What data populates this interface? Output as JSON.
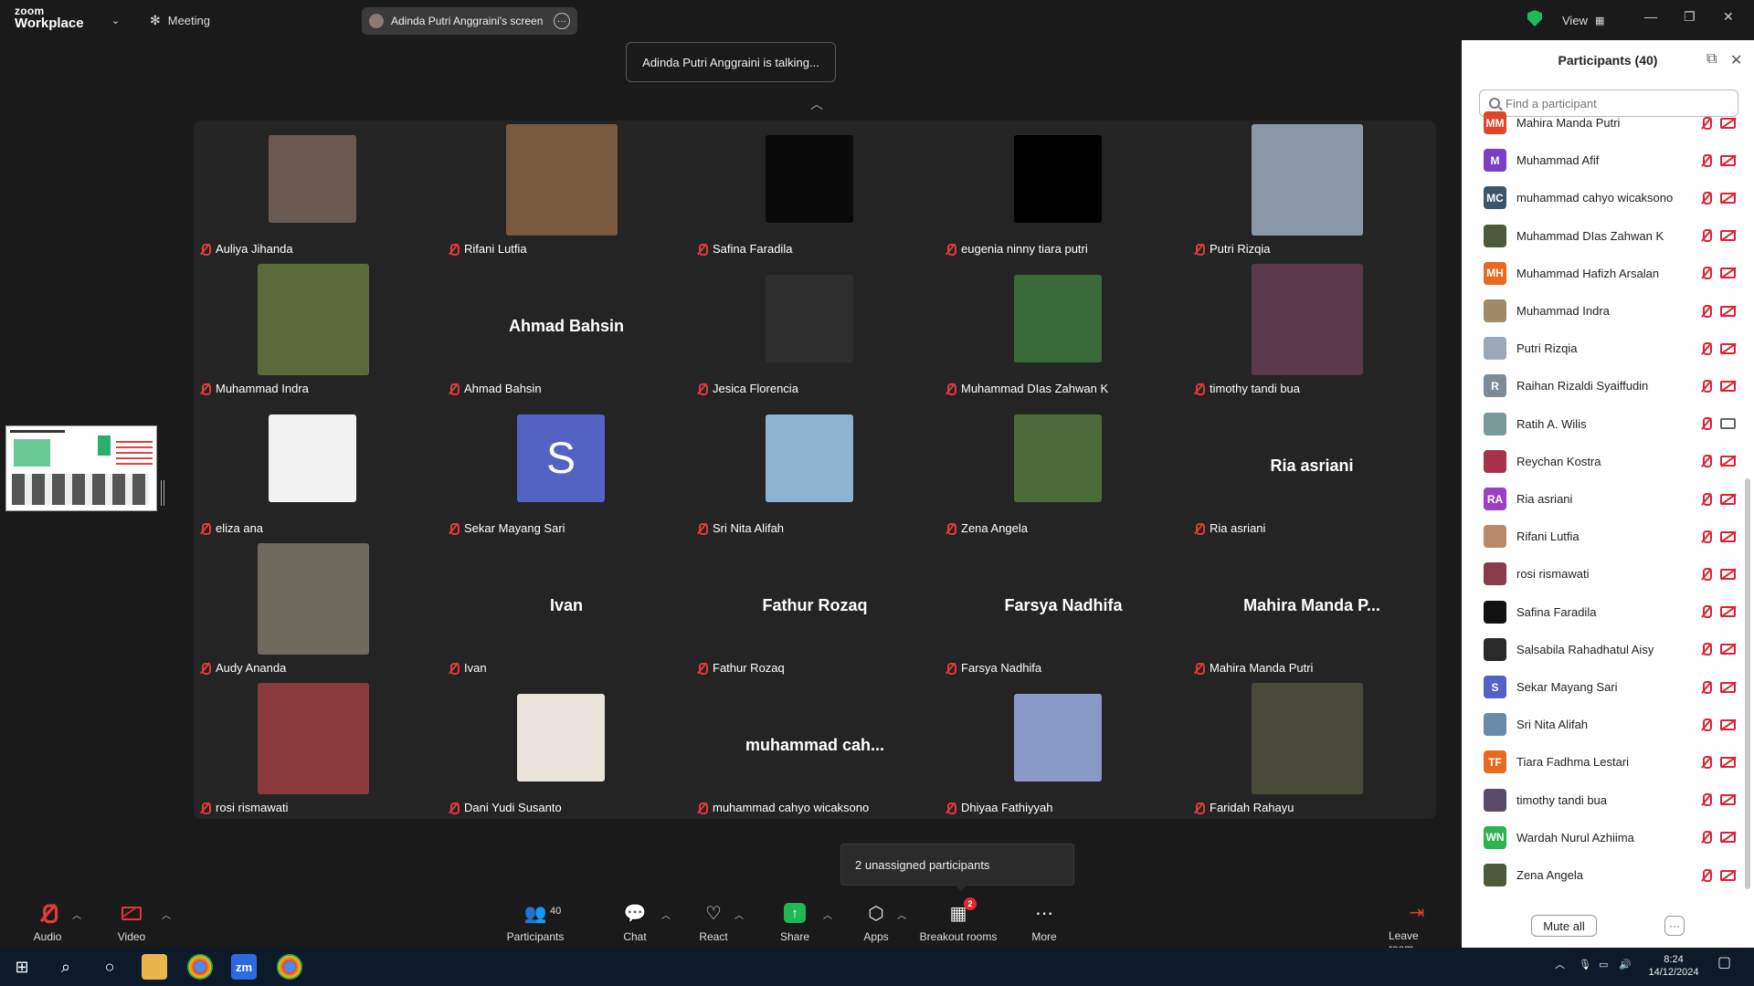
{
  "app": {
    "brand_top": "zoom",
    "brand_bottom": "Workplace",
    "meeting_label": "Meeting",
    "share_pill": "Adinda Putri Anggraini's screen",
    "view_label": "View"
  },
  "talking_banner": "Adinda Putri Anggraini is talking...",
  "tiles": [
    {
      "name": "Auliya Jihanda",
      "type": "photo",
      "color": "#6b5a52"
    },
    {
      "name": "Rifani Lutfia",
      "type": "photo",
      "color": "#7a5a3e"
    },
    {
      "name": "Safina Faradila",
      "type": "photo",
      "color": "#0a0a0a"
    },
    {
      "name": "eugenia ninny tiara putri",
      "type": "photo",
      "color": "#000000"
    },
    {
      "name": "Putri Rizqia",
      "type": "photo",
      "color": "#8a98a8"
    },
    {
      "name": "Muhammad Indra",
      "type": "photo",
      "color": "#5a6a3a"
    },
    {
      "name": "Ahmad Bahsin",
      "type": "text",
      "big": "Ahmad Bahsin"
    },
    {
      "name": "Jesica Florencia",
      "type": "photo",
      "color": "#2e2e2e"
    },
    {
      "name": "Muhammad DIas Zahwan K",
      "type": "photo",
      "color": "#3b6a3a"
    },
    {
      "name": "timothy tandi bua",
      "type": "photo",
      "color": "#5a3a4a"
    },
    {
      "name": "eliza ana",
      "type": "photo",
      "color": "#f2f2f2"
    },
    {
      "name": "Sekar Mayang Sari",
      "type": "avatar",
      "letter": "S",
      "color": "#5462c4"
    },
    {
      "name": "Sri Nita Alifah",
      "type": "photo",
      "color": "#8fb3cf"
    },
    {
      "name": "Zena Angela",
      "type": "photo",
      "color": "#4d6a3a"
    },
    {
      "name": "Ria asriani",
      "type": "text",
      "big": "Ria asriani"
    },
    {
      "name": "Audy Ananda",
      "type": "photo",
      "color": "#6e6a5e"
    },
    {
      "name": "Ivan",
      "type": "text",
      "big": "Ivan"
    },
    {
      "name": "Fathur Rozaq",
      "type": "text",
      "big": "Fathur Rozaq"
    },
    {
      "name": "Farsya Nadhifa",
      "type": "text",
      "big": "Farsya Nadhifa"
    },
    {
      "name": "Mahira Manda Putri",
      "type": "text",
      "big": "Mahira Manda P..."
    },
    {
      "name": "rosi rismawati",
      "type": "photo",
      "color": "#8a3a3a"
    },
    {
      "name": "Dani Yudi Susanto",
      "type": "photo",
      "color": "#e9e3da"
    },
    {
      "name": "muhammad cahyo wicaksono",
      "type": "text",
      "big": "muhammad  cah..."
    },
    {
      "name": "Dhiyaa Fathiyyah",
      "type": "photo",
      "color": "#8a9ac8"
    },
    {
      "name": "Faridah Rahayu",
      "type": "photo",
      "color": "#4a4a3a"
    }
  ],
  "panel": {
    "title": "Participants (40)",
    "search_placeholder": "Find a participant",
    "participants": [
      {
        "name": "Mahira Manda Putri",
        "initials": "MM",
        "color": "#e0452b",
        "cam": "off"
      },
      {
        "name": "Muhammad Afif",
        "initials": "M",
        "color": "#7b3fc4",
        "cam": "off"
      },
      {
        "name": "muhammad cahyo wicaksono",
        "initials": "MC",
        "color": "#3d5568",
        "cam": "off"
      },
      {
        "name": "Muhammad DIas Zahwan K",
        "initials": "",
        "color": "#4a5a3a",
        "cam": "off"
      },
      {
        "name": "Muhammad Hafizh Arsalan",
        "initials": "MH",
        "color": "#e86a1f",
        "cam": "off"
      },
      {
        "name": "Muhammad Indra",
        "initials": "",
        "color": "#a08a6a",
        "cam": "off"
      },
      {
        "name": "Putri Rizqia",
        "initials": "",
        "color": "#9aa8b8",
        "cam": "off"
      },
      {
        "name": "Raihan Rizaldi Syaiffudin",
        "initials": "R",
        "color": "#7c8a99",
        "cam": "off"
      },
      {
        "name": "Ratih A. Wilis",
        "initials": "",
        "color": "#7a9a9a",
        "cam": "on"
      },
      {
        "name": "Reychan Kostra",
        "initials": "",
        "color": "#a8324a",
        "cam": "off"
      },
      {
        "name": "Ria asriani",
        "initials": "RA",
        "color": "#9b3fc4",
        "cam": "off"
      },
      {
        "name": "Rifani Lutfia",
        "initials": "",
        "color": "#b88a6a",
        "cam": "off"
      },
      {
        "name": "rosi rismawati",
        "initials": "",
        "color": "#8a3a4a",
        "cam": "off"
      },
      {
        "name": "Safina Faradila",
        "initials": "",
        "color": "#111111",
        "cam": "off"
      },
      {
        "name": "Salsabila Rahadhatul Aisy",
        "initials": "",
        "color": "#2a2a2a",
        "cam": "off"
      },
      {
        "name": "Sekar Mayang Sari",
        "initials": "S",
        "color": "#5462c4",
        "cam": "off"
      },
      {
        "name": "Sri Nita Alifah",
        "initials": "",
        "color": "#6a8aaa",
        "cam": "off"
      },
      {
        "name": "Tiara Fadhma Lestari",
        "initials": "TF",
        "color": "#e86a1f",
        "cam": "off"
      },
      {
        "name": "timothy tandi bua",
        "initials": "",
        "color": "#5a4a6a",
        "cam": "off"
      },
      {
        "name": "Wardah Nurul Azhiima",
        "initials": "WN",
        "color": "#2db352",
        "cam": "off"
      },
      {
        "name": "Zena Angela",
        "initials": "",
        "color": "#4a5a3a",
        "cam": "off"
      }
    ],
    "mute_all": "Mute all",
    "more_dots": "···"
  },
  "unassigned": "2 unassigned participants",
  "toolbar": {
    "audio": "Audio",
    "video": "Video",
    "participants": "Participants",
    "participants_count": "40",
    "chat": "Chat",
    "react": "React",
    "share": "Share",
    "apps": "Apps",
    "breakout": "Breakout rooms",
    "breakout_badge": "2",
    "more": "More",
    "leave": "Leave room"
  },
  "taskbar": {
    "time": "8:24",
    "date": "14/12/2024",
    "zoom_icon": "zm"
  },
  "icons": {
    "accent_green": "#1db954",
    "mute_red": "#e03a3a",
    "shield": "shield-icon"
  }
}
